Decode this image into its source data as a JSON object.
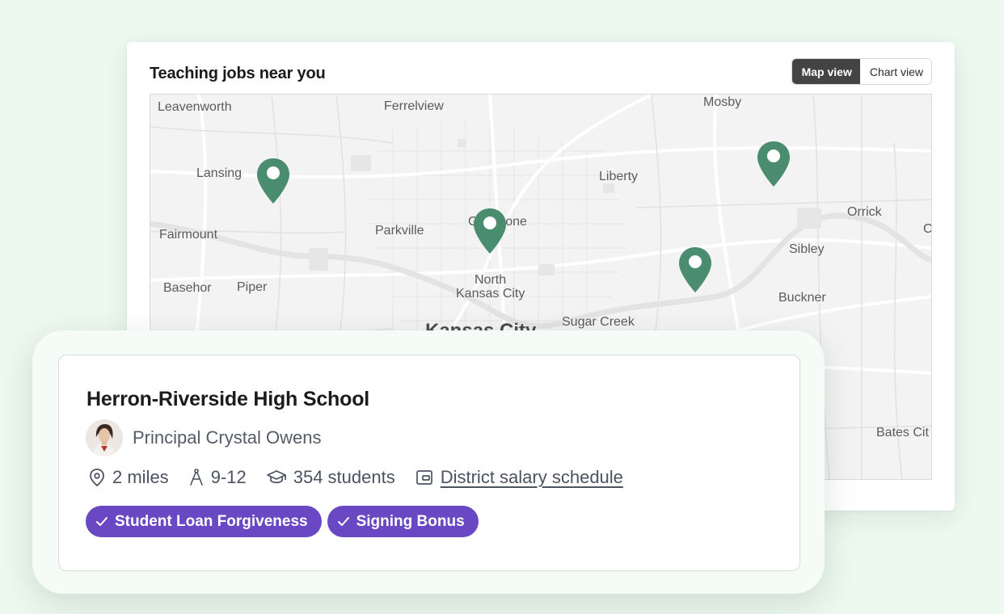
{
  "map_card": {
    "title": "Teaching jobs near you",
    "view_toggle": {
      "map_label": "Map view",
      "chart_label": "Chart view",
      "selected": "Map view"
    },
    "places": {
      "leavenworth": "Leavenworth",
      "ferrelview": "Ferrelview",
      "mosby": "Mosby",
      "lansing": "Lansing",
      "liberty": "Liberty",
      "orrick": "Orrick",
      "edge_c": "C",
      "fairmount": "Fairmount",
      "parkville": "Parkville",
      "gladstone": "Gladstone",
      "sibley": "Sibley",
      "basehor": "Basehor",
      "piper": "Piper",
      "north_kc_1": "North",
      "north_kc_2": "Kansas City",
      "buckner": "Buckner",
      "sugar_creek": "Sugar Creek",
      "kansas_city": "Kansas City",
      "bates_city": "Bates Cit"
    },
    "pin_color": "#4a8c6e"
  },
  "job_card": {
    "school_name": "Herron-Riverside High School",
    "principal": "Principal Crystal Owens",
    "distance": "2 miles",
    "grades": "9-12",
    "students": "354 students",
    "salary_link": "District salary schedule",
    "tags": [
      "Student Loan Forgiveness",
      "Signing Bonus"
    ],
    "tag_color": "#6a48c3"
  }
}
